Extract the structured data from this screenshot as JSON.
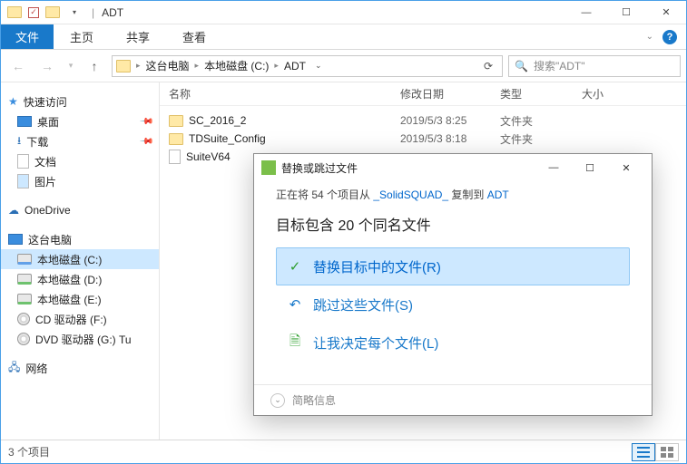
{
  "titlebar": {
    "separator": "|",
    "title": "ADT"
  },
  "ribbon": {
    "file": "文件",
    "tabs": [
      "主页",
      "共享",
      "查看"
    ]
  },
  "nav": {
    "breadcrumb": [
      "这台电脑",
      "本地磁盘 (C:)",
      "ADT"
    ],
    "search_placeholder": "搜索\"ADT\""
  },
  "sidebar": {
    "quick": {
      "head": "快速访问",
      "items": [
        "桌面",
        "下载",
        "文档",
        "图片"
      ]
    },
    "onedrive": "OneDrive",
    "thispc": {
      "head": "这台电脑",
      "items": [
        "本地磁盘 (C:)",
        "本地磁盘 (D:)",
        "本地磁盘 (E:)",
        "CD 驱动器 (F:)",
        "DVD 驱动器 (G:) Tu"
      ]
    },
    "network": "网络"
  },
  "columns": [
    "名称",
    "修改日期",
    "类型",
    "大小"
  ],
  "rows": [
    {
      "name": "SC_2016_2",
      "date": "2019/5/3 8:25",
      "type": "文件夹"
    },
    {
      "name": "TDSuite_Config",
      "date": "2019/5/3 8:18",
      "type": "文件夹"
    },
    {
      "name": "SuiteV64",
      "date": "",
      "type": ""
    }
  ],
  "status": {
    "text": "3 个项目"
  },
  "dialog": {
    "title": "替换或跳过文件",
    "progress_pre": "正在将 54 个项目从 ",
    "progress_src": "_SolidSQUAD_",
    "progress_mid": " 复制到 ",
    "progress_dst": "ADT",
    "heading": "目标包含 20 个同名文件",
    "opt_replace": "替换目标中的文件(R)",
    "opt_skip": "跳过这些文件(S)",
    "opt_decide": "让我决定每个文件(L)",
    "footer": "简略信息"
  }
}
